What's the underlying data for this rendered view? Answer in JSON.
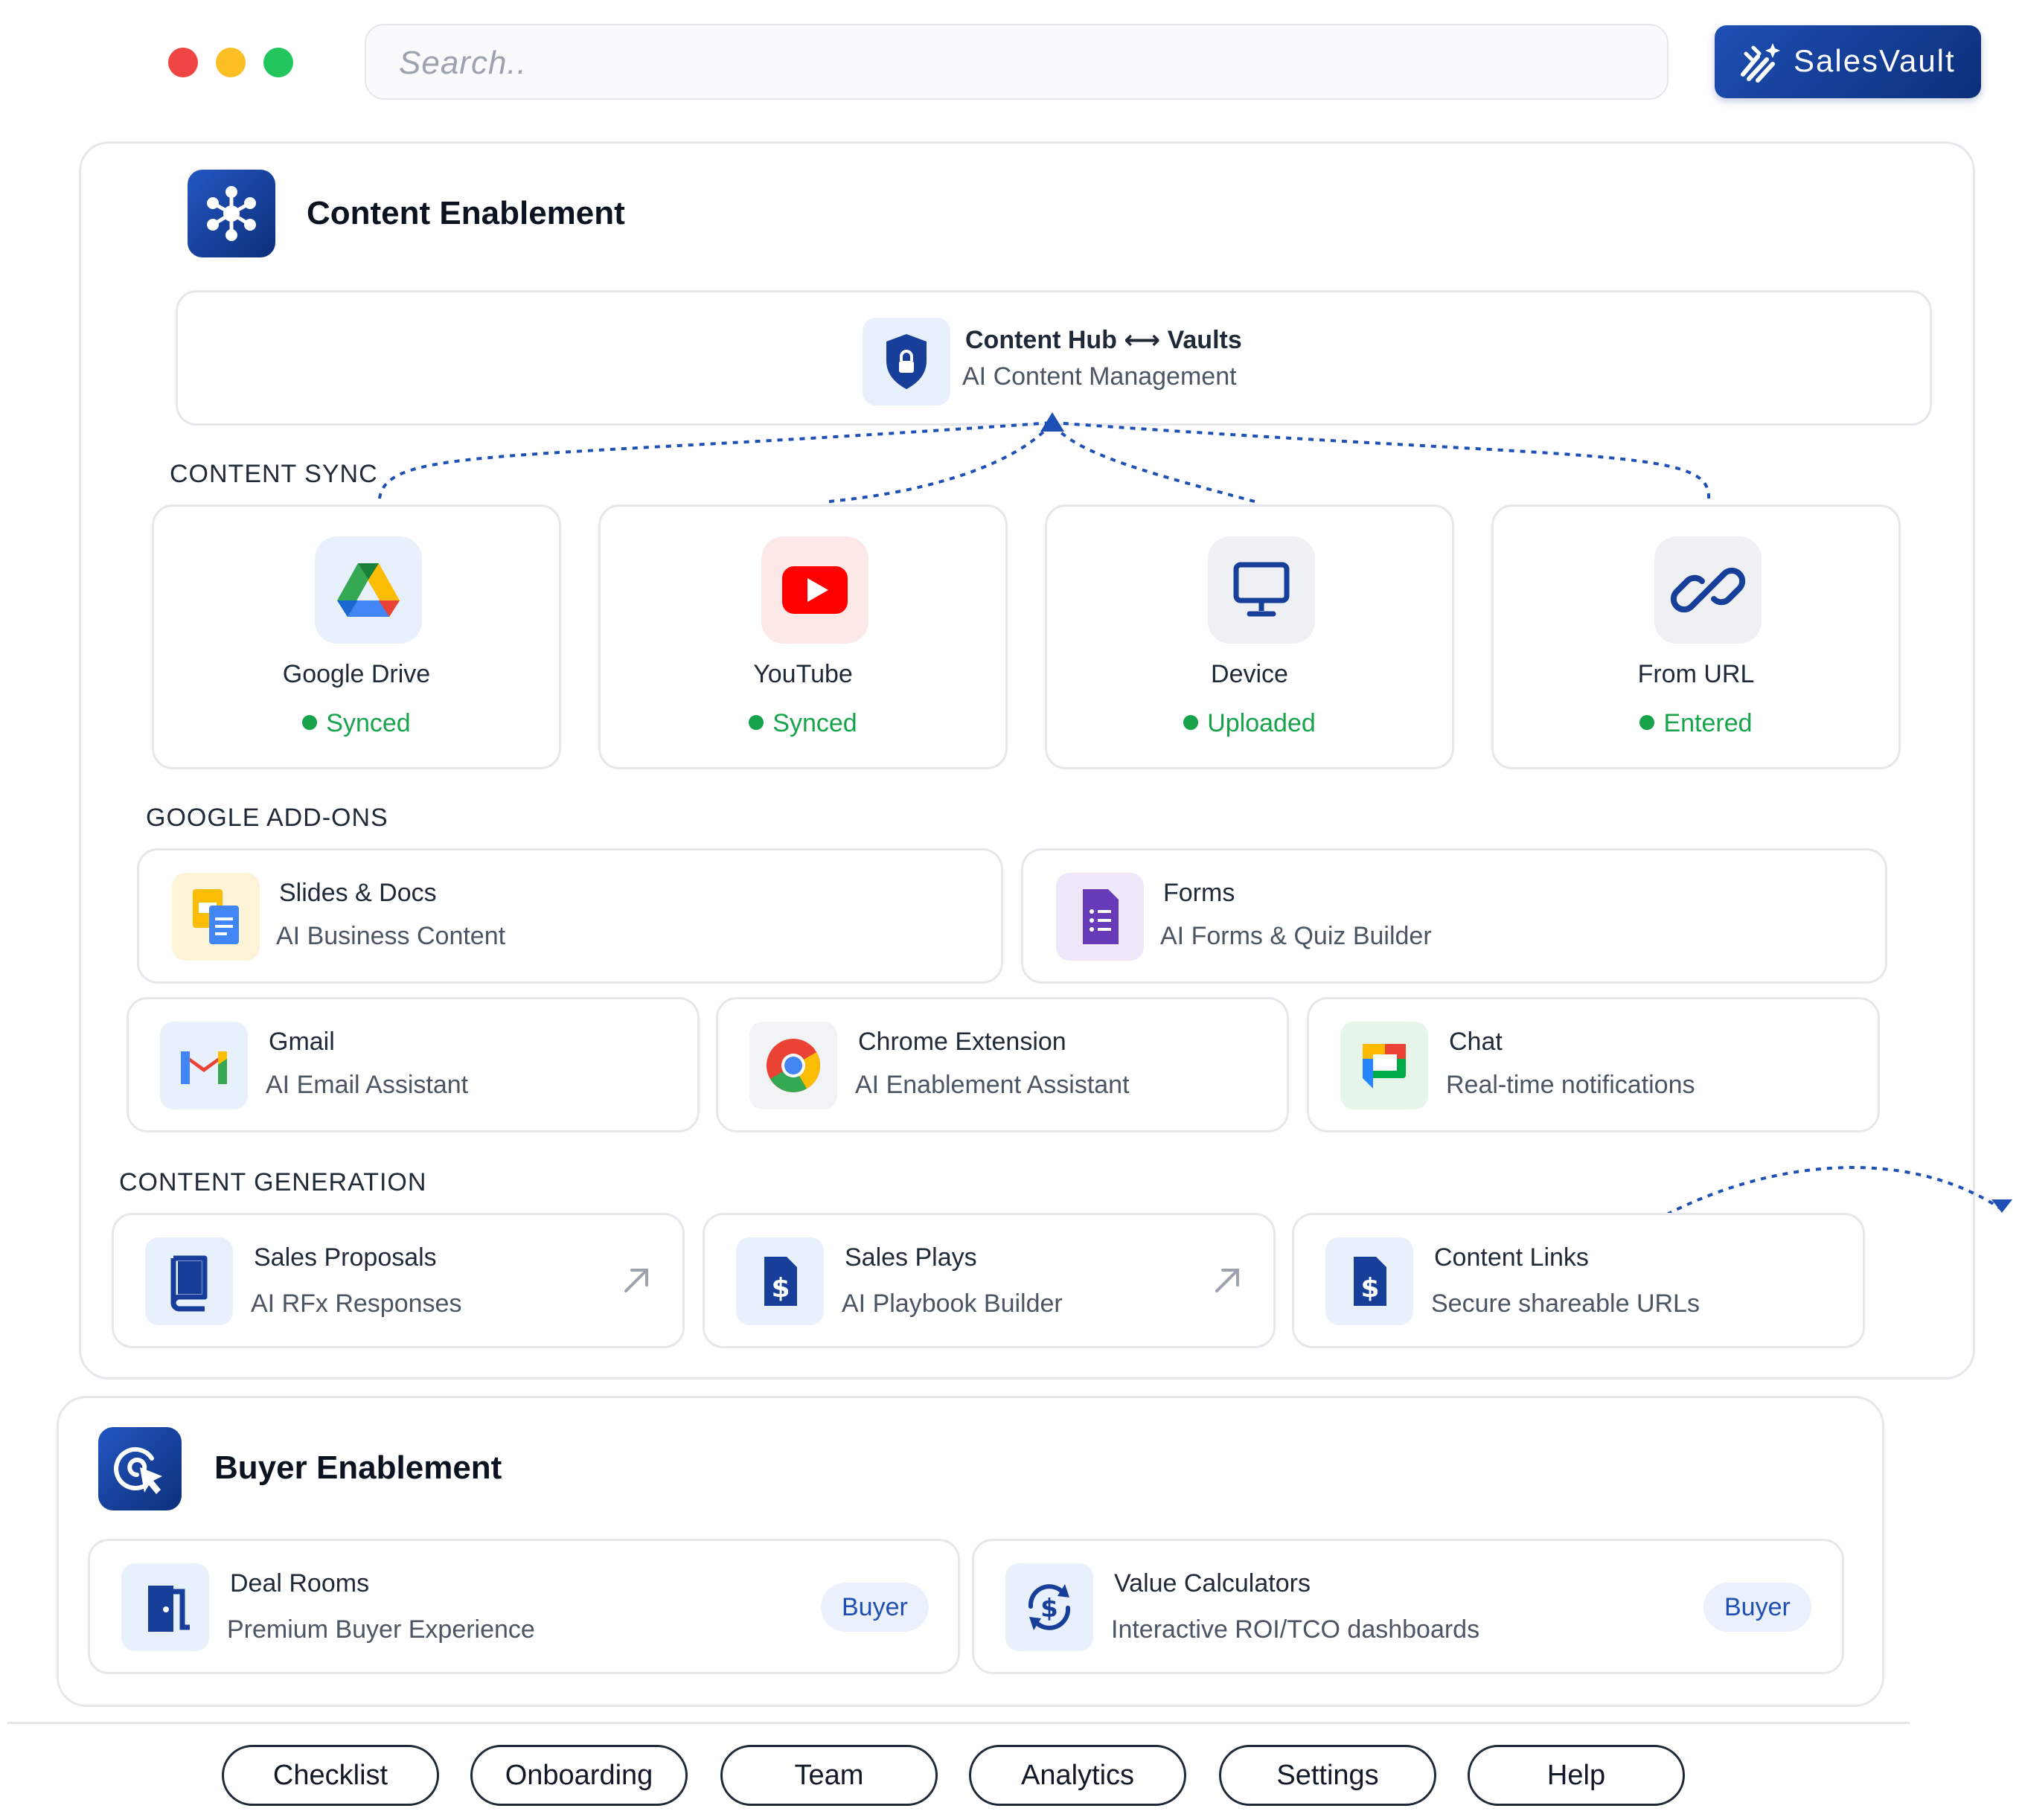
{
  "window": {
    "dots": [
      "#ef4444",
      "#fbbf24",
      "#22c55e"
    ]
  },
  "search": {
    "placeholder": "Search.."
  },
  "brand": {
    "name": "SalesVault",
    "color": "#1e4fb4"
  },
  "content_enablement": {
    "title": "Content Enablement",
    "icon": "network-hub-icon",
    "hub": {
      "title": "Content Hub ⟷ Vaults",
      "subtitle": "AI Content Management",
      "icon": "shield-lock-icon"
    },
    "sync_label": "CONTENT SYNC",
    "sync_sources": [
      {
        "name": "Google Drive",
        "status": "Synced",
        "icon": "google-drive-icon"
      },
      {
        "name": "YouTube",
        "status": "Synced",
        "icon": "youtube-icon"
      },
      {
        "name": "Device",
        "status": "Uploaded",
        "icon": "monitor-icon"
      },
      {
        "name": "From URL",
        "status": "Entered",
        "icon": "link-icon"
      }
    ],
    "addons_label": "GOOGLE ADD-ONS",
    "addons": [
      {
        "title": "Slides & Docs",
        "subtitle": "AI Business Content",
        "icon": "slides-docs-icon"
      },
      {
        "title": "Forms",
        "subtitle": "AI Forms & Quiz Builder",
        "icon": "google-forms-icon"
      },
      {
        "title": "Gmail",
        "subtitle": "AI Email Assistant",
        "icon": "gmail-icon"
      },
      {
        "title": "Chrome Extension",
        "subtitle": "AI Enablement Assistant",
        "icon": "chrome-icon"
      },
      {
        "title": "Chat",
        "subtitle": "Real-time notifications",
        "icon": "google-chat-icon"
      }
    ],
    "generation_label": "CONTENT GENERATION",
    "generation": [
      {
        "title": "Sales Proposals",
        "subtitle": "AI RFx Responses",
        "icon": "book-icon",
        "action_icon": "arrow-up-right-icon"
      },
      {
        "title": "Sales Plays",
        "subtitle": "AI Playbook Builder",
        "icon": "dollar-file-icon",
        "action_icon": "arrow-up-right-icon"
      },
      {
        "title": "Content Links",
        "subtitle": "Secure shareable URLs",
        "icon": "dollar-file-icon"
      }
    ]
  },
  "buyer_enablement": {
    "title": "Buyer Enablement",
    "icon": "cursor-target-icon",
    "items": [
      {
        "title": "Deal Rooms",
        "subtitle": "Premium Buyer Experience",
        "badge": "Buyer",
        "icon": "door-icon"
      },
      {
        "title": "Value Calculators",
        "subtitle": "Interactive ROI/TCO dashboards",
        "badge": "Buyer",
        "icon": "dollar-cycle-icon"
      }
    ]
  },
  "bottom_nav": [
    "Checklist",
    "Onboarding",
    "Team",
    "Analytics",
    "Settings",
    "Help"
  ]
}
